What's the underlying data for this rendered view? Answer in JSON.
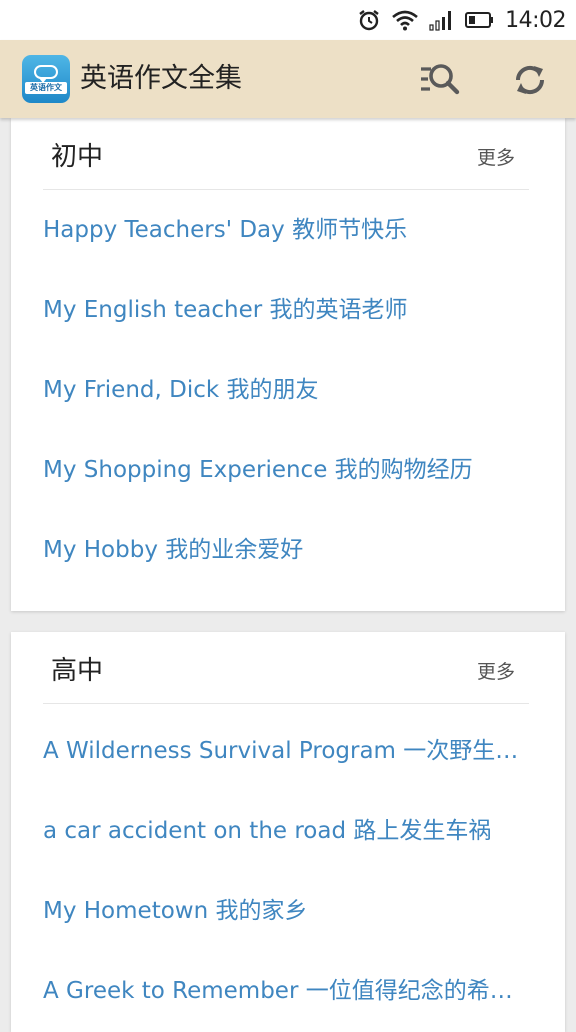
{
  "status_bar": {
    "time": "14:02",
    "icons": [
      "alarm-icon",
      "wifi-icon",
      "signal-icon",
      "battery-icon"
    ]
  },
  "app_bar": {
    "title": "英语作文全集",
    "logo_text": "英语作文",
    "actions": [
      "search-icon",
      "refresh-icon"
    ]
  },
  "colors": {
    "app_bar_bg": "#ede0c6",
    "link": "#3f86c0",
    "background": "#ececec"
  },
  "sections": [
    {
      "title": "初中",
      "more": "更多",
      "items": [
        "Happy Teachers' Day 教师节快乐",
        "My English teacher 我的英语老师",
        "My Friend, Dick 我的朋友",
        "My Shopping Experience 我的购物经历",
        "My Hobby 我的业余爱好"
      ]
    },
    {
      "title": "高中",
      "more": "更多",
      "items": [
        "A Wilderness Survival Program 一次野生动物生存计划",
        "a car accident on the road 路上发生车祸",
        "My Hometown 我的家乡",
        "A Greek to Remember 一位值得纪念的希腊人"
      ]
    }
  ]
}
